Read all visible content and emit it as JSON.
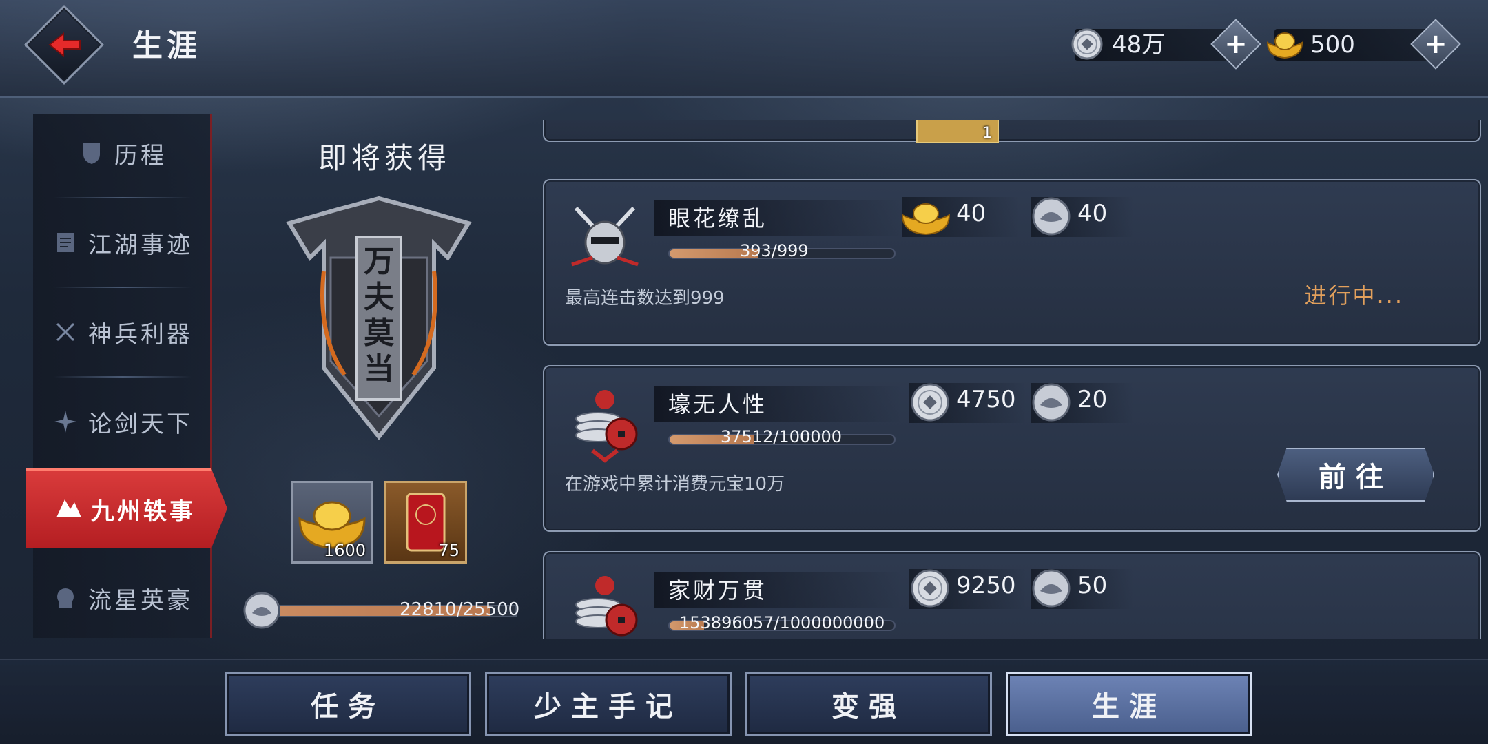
{
  "header": {
    "title": "生涯",
    "silver": "48万",
    "gold": "500"
  },
  "sidebar": {
    "items": [
      {
        "label": "历程"
      },
      {
        "label": "江湖事迹"
      },
      {
        "label": "神兵利器"
      },
      {
        "label": "论剑天下"
      },
      {
        "label": "九州轶事"
      },
      {
        "label": "流星英豪"
      }
    ],
    "active_index": 4
  },
  "preview": {
    "title": "即将获得",
    "badge_text": "万夫莫当",
    "items": [
      {
        "name": "gold-ingot",
        "count": "1600"
      },
      {
        "name": "red-banner",
        "count": "75"
      }
    ],
    "progress_text": "22810/25500",
    "progress": 0.8945
  },
  "cards": [
    {
      "partial_top": true,
      "item_count": "1"
    },
    {
      "title": "眼花缭乱",
      "progress_text": "393/999",
      "progress": 0.393,
      "description": "最高连击数达到999",
      "rewards": [
        {
          "icon": "gold-ingot-icon",
          "value": "40"
        },
        {
          "icon": "lotus-coin-icon",
          "value": "40"
        }
      ],
      "status": "进行中..."
    },
    {
      "title": "壕无人性",
      "progress_text": "37512/100000",
      "progress": 0.375,
      "description": "在游戏中累计消费元宝10万",
      "rewards": [
        {
          "icon": "silver-coin-icon",
          "value": "4750"
        },
        {
          "icon": "lotus-coin-icon",
          "value": "20"
        }
      ],
      "button": "前往"
    },
    {
      "title": "家财万贯",
      "progress_text": "153896057/1000000000",
      "progress": 0.154,
      "rewards": [
        {
          "icon": "silver-coin-icon",
          "value": "9250"
        },
        {
          "icon": "lotus-coin-icon",
          "value": "50"
        }
      ]
    }
  ],
  "bottom_nav": [
    {
      "label": "任务"
    },
    {
      "label": "少主手记"
    },
    {
      "label": "变强"
    },
    {
      "label": "生涯"
    }
  ],
  "colors": {
    "accent_red": "#c52a2c",
    "progress_orange": "#c98a60",
    "status_orange": "#e2a05c"
  }
}
